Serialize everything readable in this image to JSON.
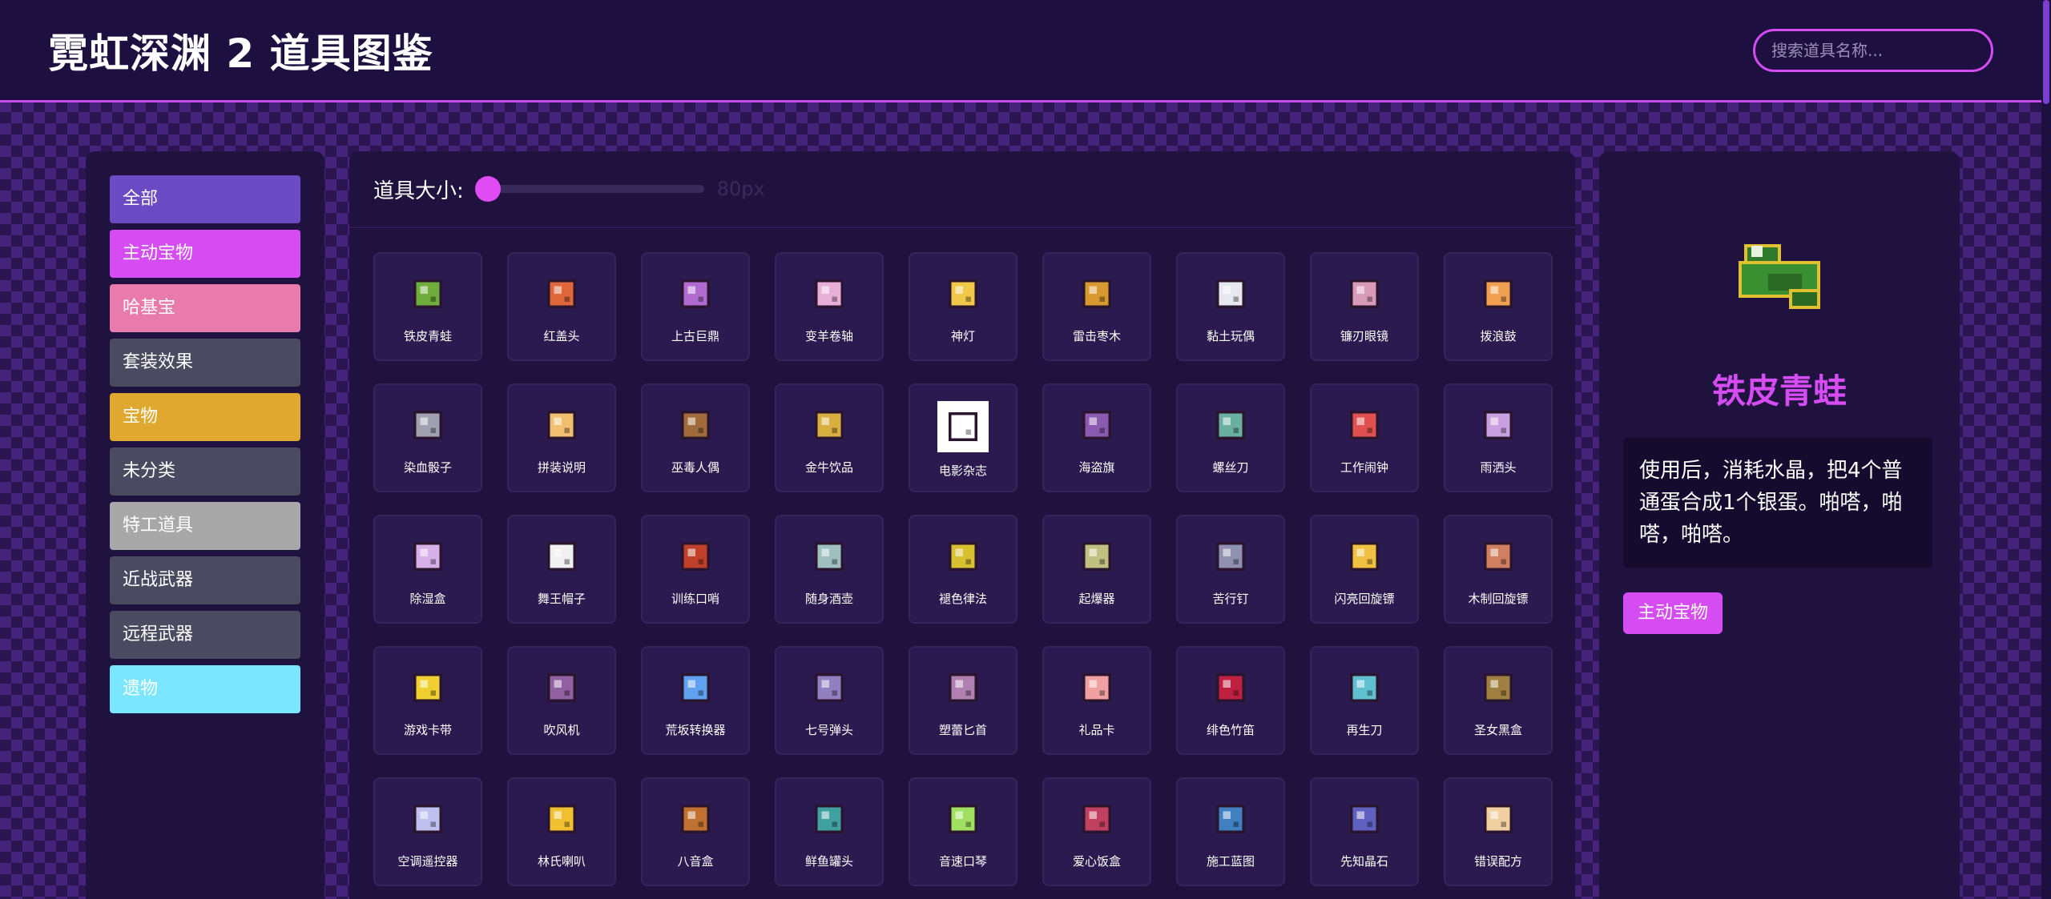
{
  "header": {
    "title": "霓虹深渊 2 道具图鉴",
    "search_placeholder": "搜索道具名称..."
  },
  "categories": [
    {
      "label": "全部",
      "color": "#6a4bc4"
    },
    {
      "label": "主动宝物",
      "color": "#d44cf2"
    },
    {
      "label": "哈基宝",
      "color": "#e87aac"
    },
    {
      "label": "套装效果",
      "color": "#4a4b61"
    },
    {
      "label": "宝物",
      "color": "#e0a82e"
    },
    {
      "label": "未分类",
      "color": "#4a4b61"
    },
    {
      "label": "特工道具",
      "color": "#a8a8a8"
    },
    {
      "label": "近战武器",
      "color": "#4a4b61"
    },
    {
      "label": "远程武器",
      "color": "#4a4b61"
    },
    {
      "label": "遗物",
      "color": "#7ae6ff"
    }
  ],
  "size_control": {
    "label": "道具大小:",
    "value": "80px",
    "level": 0
  },
  "items": [
    {
      "name": "铁皮青蛙",
      "icon": "frog-icon"
    },
    {
      "name": "红盖头",
      "icon": "red-veil-icon"
    },
    {
      "name": "上古巨鼎",
      "icon": "cauldron-icon"
    },
    {
      "name": "变羊卷轴",
      "icon": "scroll-icon"
    },
    {
      "name": "神灯",
      "icon": "magic-lamp-icon"
    },
    {
      "name": "雷击枣木",
      "icon": "wood-icon"
    },
    {
      "name": "黏土玩偶",
      "icon": "clay-doll-icon"
    },
    {
      "name": "镰刃眼镜",
      "icon": "sickle-glasses-icon"
    },
    {
      "name": "拨浪鼓",
      "icon": "rattle-drum-icon"
    },
    {
      "name": "染血骰子",
      "icon": "dice-icon"
    },
    {
      "name": "拼装说明",
      "icon": "manual-icon"
    },
    {
      "name": "巫毒人偶",
      "icon": "voodoo-icon"
    },
    {
      "name": "金牛饮品",
      "icon": "drink-can-icon"
    },
    {
      "name": "电影杂志",
      "icon": "magazine-icon"
    },
    {
      "name": "海盗旗",
      "icon": "pirate-flag-icon"
    },
    {
      "name": "螺丝刀",
      "icon": "screwdriver-icon"
    },
    {
      "name": "工作闹钟",
      "icon": "alarm-clock-icon"
    },
    {
      "name": "雨洒头",
      "icon": "shower-head-icon"
    },
    {
      "name": "除湿盒",
      "icon": "dehumidifier-icon"
    },
    {
      "name": "舞王帽子",
      "icon": "hat-icon"
    },
    {
      "name": "训练口哨",
      "icon": "whistle-icon"
    },
    {
      "name": "随身酒壶",
      "icon": "flask-icon"
    },
    {
      "name": "褪色律法",
      "icon": "law-book-icon"
    },
    {
      "name": "起爆器",
      "icon": "detonator-icon"
    },
    {
      "name": "苦行钉",
      "icon": "nail-icon"
    },
    {
      "name": "闪亮回旋镖",
      "icon": "boomerang-icon"
    },
    {
      "name": "木制回旋镖",
      "icon": "wood-boomerang-icon"
    },
    {
      "name": "游戏卡带",
      "icon": "cartridge-icon"
    },
    {
      "name": "吹风机",
      "icon": "hair-dryer-icon"
    },
    {
      "name": "荒坂转换器",
      "icon": "converter-icon"
    },
    {
      "name": "七号弹头",
      "icon": "bullet-icon"
    },
    {
      "name": "塑蕾匕首",
      "icon": "dagger-icon"
    },
    {
      "name": "礼品卡",
      "icon": "gift-card-icon"
    },
    {
      "name": "绯色竹笛",
      "icon": "flute-icon"
    },
    {
      "name": "再生刀",
      "icon": "regen-knife-icon"
    },
    {
      "name": "圣女黑盒",
      "icon": "black-box-icon"
    },
    {
      "name": "空调遥控器",
      "icon": "remote-icon"
    },
    {
      "name": "林氏喇叭",
      "icon": "horn-icon"
    },
    {
      "name": "八音盒",
      "icon": "music-box-icon"
    },
    {
      "name": "鲜鱼罐头",
      "icon": "fish-can-icon"
    },
    {
      "name": "音速口琴",
      "icon": "harmonica-icon"
    },
    {
      "name": "爱心饭盒",
      "icon": "lunch-box-icon"
    },
    {
      "name": "施工蓝图",
      "icon": "blueprint-icon"
    },
    {
      "name": "先知晶石",
      "icon": "crystal-icon"
    },
    {
      "name": "错误配方",
      "icon": "recipe-icon"
    }
  ],
  "detail": {
    "name": "铁皮青蛙",
    "icon": "frog-icon",
    "description": "使用后，消耗水晶，把4个普通蛋合成1个银蛋。啪嗒，啪嗒，啪嗒。",
    "tag": "主动宝物",
    "tag_color": "#d44cf2"
  }
}
